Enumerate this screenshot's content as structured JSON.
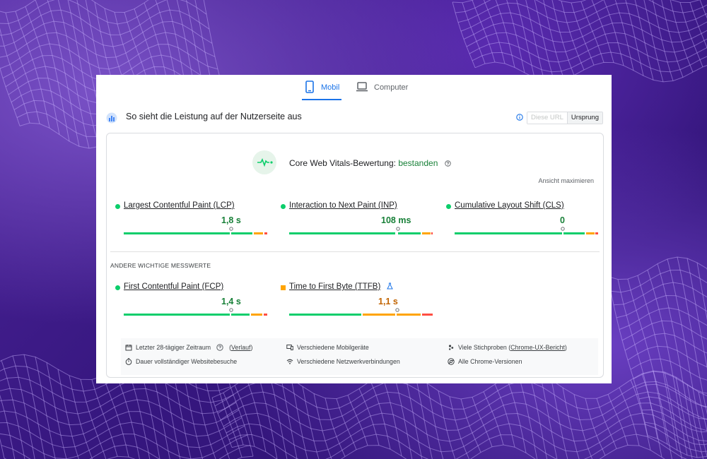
{
  "tabs": [
    {
      "label": "Mobil",
      "icon": "smartphone-icon",
      "active": true
    },
    {
      "label": "Computer",
      "icon": "laptop-icon",
      "active": false
    }
  ],
  "header": {
    "title": "So sieht die Leistung auf der Nutzerseite aus",
    "toggle": {
      "option_url": "Diese URL",
      "option_origin": "Ursprung",
      "selected": "Ursprung"
    }
  },
  "cwv": {
    "label": "Core Web Vitals-Bewertung:",
    "status": "bestanden",
    "expand": "Ansicht maximieren"
  },
  "metrics": [
    {
      "name": "Largest Contentful Paint (LCP)",
      "value": "1,8 s",
      "rating": "good"
    },
    {
      "name": "Interaction to Next Paint (INP)",
      "value": "108 ms",
      "rating": "good"
    },
    {
      "name": "Cumulative Layout Shift (CLS)",
      "value": "0",
      "rating": "good"
    }
  ],
  "other": {
    "title": "ANDERE WICHTIGE MESSWERTE",
    "metrics": [
      {
        "name": "First Contentful Paint (FCP)",
        "value": "1,4 s",
        "rating": "good"
      },
      {
        "name": "Time to First Byte (TTFB)",
        "value": "1,1 s",
        "rating": "average",
        "experimental": true
      }
    ]
  },
  "footer": {
    "period_prefix": "Letzter 28-tägiger Zeitraum",
    "period_link": "Verlauf",
    "devices": "Verschiedene Mobilgeräte",
    "samples_prefix": "Viele Stichproben (",
    "samples_link": "Chrome-UX-Bericht",
    "samples_suffix": ")",
    "visits": "Dauer vollständiger Websitebesuche",
    "network": "Verschiedene Netzwerkverbindungen",
    "versions": "Alle Chrome-Versionen"
  },
  "colors": {
    "good": "#0cce6b",
    "average": "#ffa400",
    "poor": "#ff4e42",
    "accent": "#1a73e8"
  }
}
